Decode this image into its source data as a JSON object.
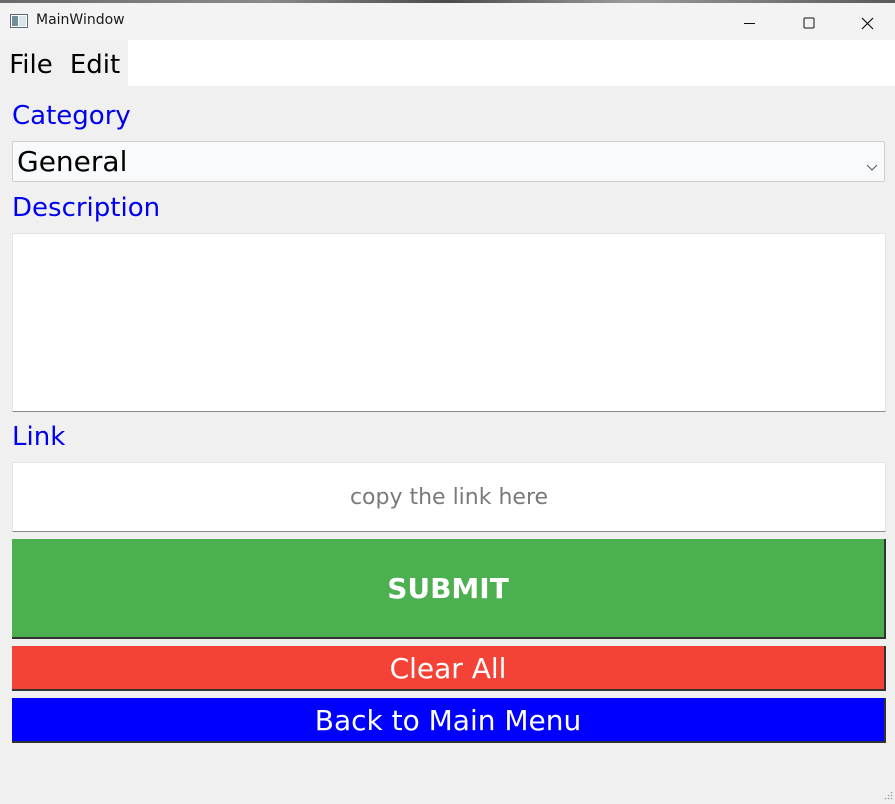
{
  "window": {
    "title": "MainWindow"
  },
  "menu": {
    "items": [
      {
        "label": "File"
      },
      {
        "label": "Edit"
      }
    ]
  },
  "form": {
    "category_label": "Category",
    "category_value": "General",
    "description_label": "Description",
    "description_value": "",
    "link_label": "Link",
    "link_placeholder": "copy the link here",
    "link_value": ""
  },
  "buttons": {
    "submit_label": "SUBMIT",
    "clear_label": "Clear All",
    "back_label": "Back to Main Menu"
  },
  "colors": {
    "label_color": "#0000ee",
    "submit_bg": "#4caf50",
    "clear_bg": "#f44336",
    "back_bg": "#0000ff"
  }
}
